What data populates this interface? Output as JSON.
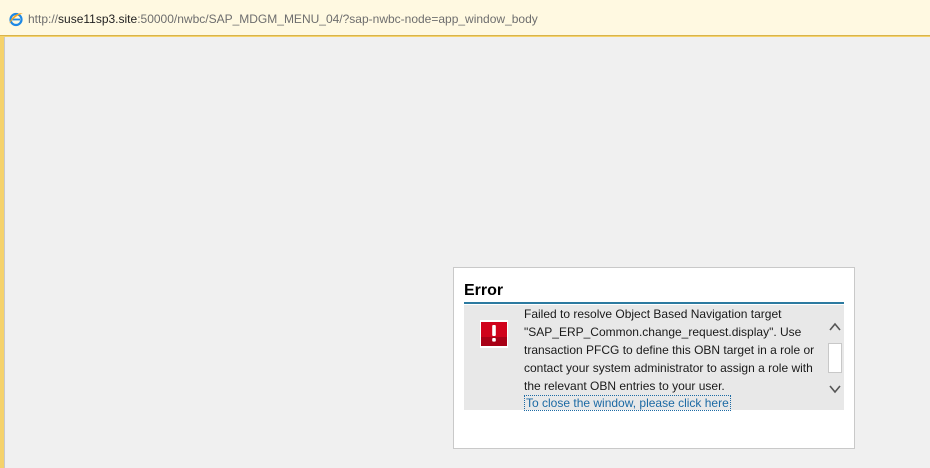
{
  "browser": {
    "url_scheme": "http://",
    "url_host": "suse11sp3.site",
    "url_rest": ":50000/nwbc/SAP_MDGM_MENU_04/?sap-nwbc-node=app_window_body",
    "icon": "ie-logo-icon"
  },
  "dialog": {
    "title": "Error",
    "icon": "error-exclamation-icon",
    "message": "Failed to resolve Object Based Navigation target \"SAP_ERP_Common.change_request.display\". Use transaction PFCG to define this OBN target in a role or contact your system administrator to assign a role with the relevant OBN entries to your user.",
    "close_link": "To close the window, please click here",
    "colors": {
      "title_rule": "#2c7aa0",
      "error_icon": "#d0021b",
      "link": "#1c6aa4"
    }
  }
}
